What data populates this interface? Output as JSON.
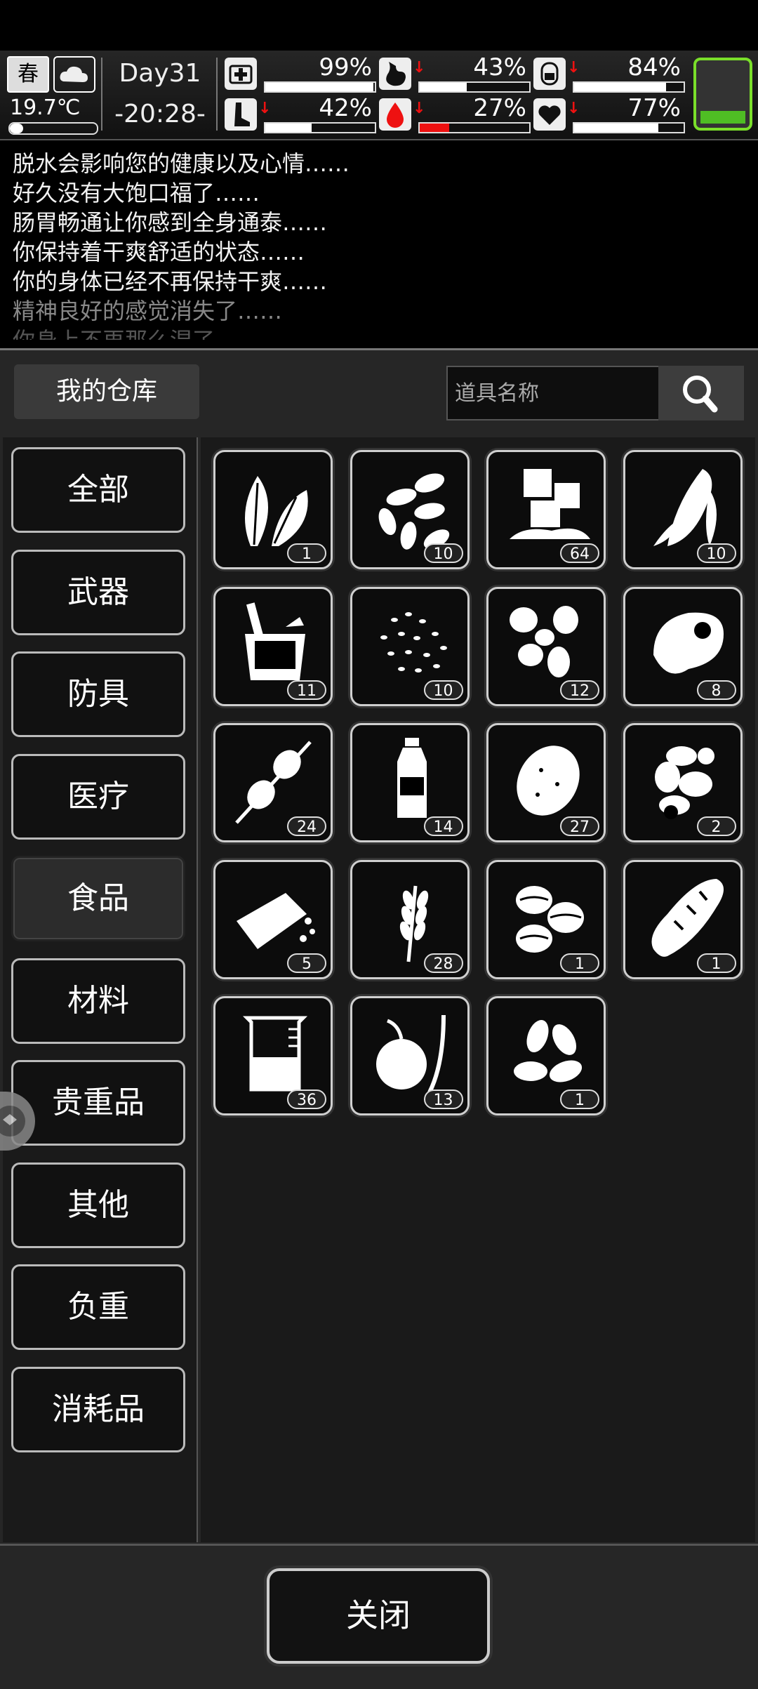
{
  "hud": {
    "season": "春",
    "weather_icon": "cloud-icon",
    "temperature": "19.7℃",
    "temperature_level": 0.15,
    "day": "Day31",
    "time": "-20:28-",
    "stats": [
      {
        "name": "health",
        "icon": "first-aid-icon",
        "pct": "99%",
        "value": 99,
        "down": false
      },
      {
        "name": "hunger",
        "icon": "stomach-icon",
        "pct": "43%",
        "value": 43,
        "down": true
      },
      {
        "name": "thirst",
        "icon": "water-jar-icon",
        "pct": "84%",
        "value": 84,
        "down": true
      },
      {
        "name": "stamina",
        "icon": "boot-icon",
        "pct": "42%",
        "value": 42,
        "down": true
      },
      {
        "name": "blood",
        "icon": "blood-drop-icon",
        "pct": "27%",
        "value": 27,
        "down": true
      },
      {
        "name": "mood",
        "icon": "heart-icon",
        "pct": "77%",
        "value": 77,
        "down": true
      }
    ],
    "battery_level": 0.2
  },
  "log": [
    "脱水会影响您的健康以及心情……",
    "好久没有大饱口福了……",
    "肠胃畅通让你感到全身通泰……",
    "你保持着干爽舒适的状态……",
    "你的身体已经不再保持干爽……",
    "精神良好的感觉消失了……",
    "你身上不再那么湿了……"
  ],
  "panel": {
    "title": "我的仓库",
    "search_placeholder": "道具名称",
    "categories": [
      "全部",
      "武器",
      "防具",
      "医疗",
      "食品",
      "材料",
      "贵重品",
      "其他",
      "负重",
      "消耗品"
    ],
    "active_category": "食品",
    "close_label": "关闭"
  },
  "items": [
    {
      "icon": "leaves-icon",
      "count": "1"
    },
    {
      "icon": "seeds-icon",
      "count": "10"
    },
    {
      "icon": "ice-cubes-icon",
      "count": "64"
    },
    {
      "icon": "corn-icon",
      "count": "10"
    },
    {
      "icon": "bucket-icon",
      "count": "11"
    },
    {
      "icon": "grain-icon",
      "count": "10"
    },
    {
      "icon": "mushroom-icon",
      "count": "12"
    },
    {
      "icon": "meat-icon",
      "count": "8"
    },
    {
      "icon": "kebab-icon",
      "count": "24"
    },
    {
      "icon": "water-bottle-icon",
      "count": "14"
    },
    {
      "icon": "potato-icon",
      "count": "27"
    },
    {
      "icon": "ginger-icon",
      "count": "2"
    },
    {
      "icon": "tofu-icon",
      "count": "5"
    },
    {
      "icon": "wheat-icon",
      "count": "28"
    },
    {
      "icon": "coffee-beans-icon",
      "count": "1"
    },
    {
      "icon": "bread-icon",
      "count": "1"
    },
    {
      "icon": "beaker-icon",
      "count": "36"
    },
    {
      "icon": "fruit-icon",
      "count": "13"
    },
    {
      "icon": "almond-icon",
      "count": "1"
    }
  ]
}
